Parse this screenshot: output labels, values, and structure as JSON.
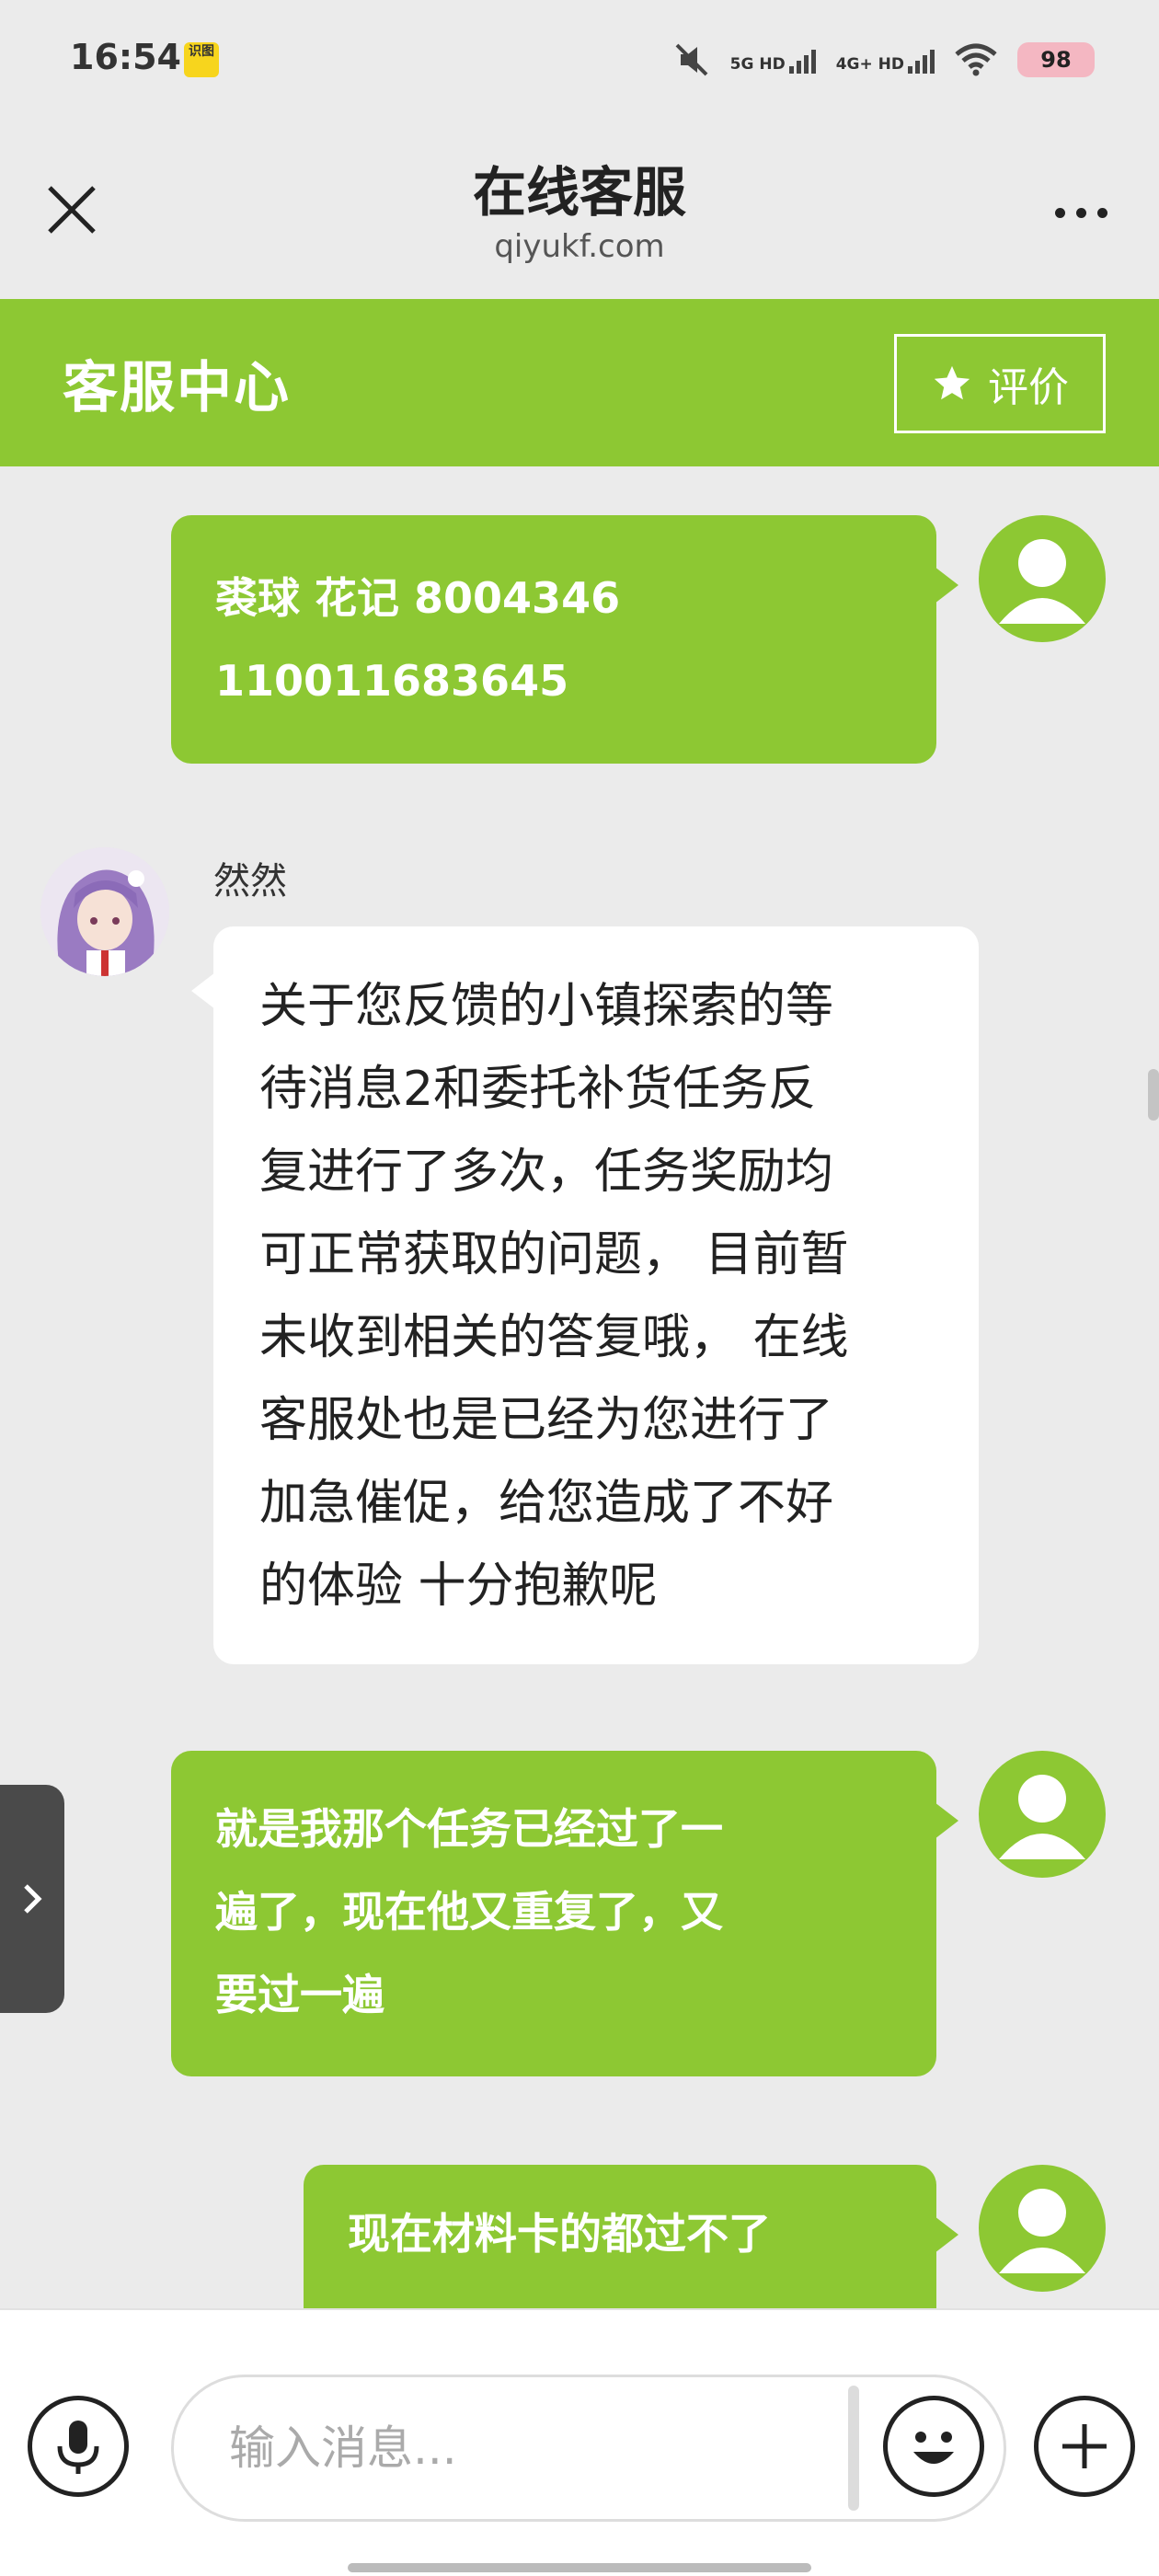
{
  "status": {
    "time": "16:54",
    "app_icon_text": "识图",
    "sig1_label": "5G HD",
    "sig2_label": "4G+ HD",
    "battery": "98"
  },
  "titlebar": {
    "title": "在线客服",
    "subtitle": "qiyukf.com"
  },
  "header": {
    "title": "客服中心",
    "rate_label": "评价"
  },
  "messages": [
    {
      "from": "user",
      "lines": [
        "裘球 花记  8004346",
        "110011683645"
      ]
    },
    {
      "from": "agent",
      "name": "然然",
      "lines": [
        "关于您反馈的小镇探索的等",
        "待消息2和委托补货任务反",
        "复进行了多次，任务奖励均",
        "可正常获取的问题， 目前暂",
        "未收到相关的答复哦， 在线",
        "客服处也是已经为您进行了",
        "加急催促，给您造成了不好",
        "的体验 十分抱歉呢"
      ]
    },
    {
      "from": "user",
      "lines": [
        "就是我那个任务已经过了一",
        "遍了，现在他又重复了，又",
        "要过一遍"
      ]
    },
    {
      "from": "user",
      "lines": [
        "现在材料卡的都过不了"
      ]
    }
  ],
  "input": {
    "placeholder": "输入消息..."
  },
  "colors": {
    "accent": "#8dc833",
    "background": "#ebebeb"
  },
  "icons": {
    "close": "close-icon",
    "more": "more-icon",
    "rate": "star-icon",
    "mic": "microphone-icon",
    "emoji": "smiley-icon",
    "plus": "plus-icon",
    "side_tab": "chevron-right-icon"
  }
}
